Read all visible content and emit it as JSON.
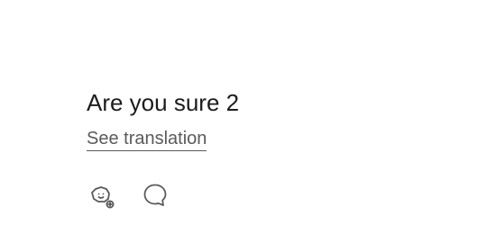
{
  "post": {
    "text": "Are you sure 2",
    "translate_label": "See translation"
  },
  "actions": [
    {
      "icon": "react-icon"
    },
    {
      "icon": "reply-icon"
    }
  ],
  "colors": {
    "text": "#1c1c1c",
    "muted": "#5a5a5a",
    "background": "#ffffff"
  }
}
